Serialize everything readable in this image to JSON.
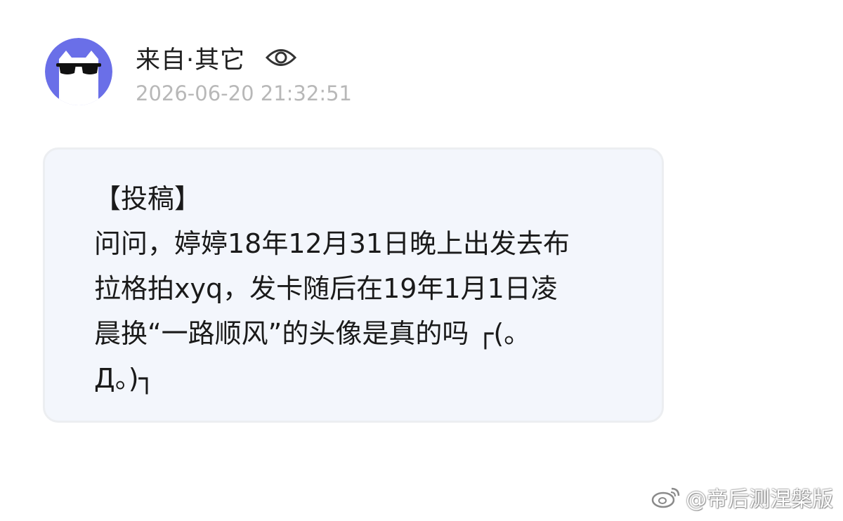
{
  "message": {
    "sender": "来自·其它",
    "timestamp": "2026-06-20 21:32:51",
    "icons": {
      "avatar": "cat-with-sunglasses-avatar",
      "visibility": "eye-icon"
    },
    "body_lines": [
      "【投稿】",
      "问问，婷婷18年12月31日晚上出发去布",
      "拉格拍xyq，发卡随后在19年1月1日凌",
      "晨换“一路顺风”的头像是真的吗 ┌(。",
      "Д。)┐"
    ]
  },
  "watermark": {
    "text": "@帝后测涅槃版",
    "icon": "weibo-icon"
  },
  "colors": {
    "avatar_bg": "#6a6fe8",
    "bubble_bg": "#f3f6fc",
    "timestamp": "#b8b8b8"
  }
}
